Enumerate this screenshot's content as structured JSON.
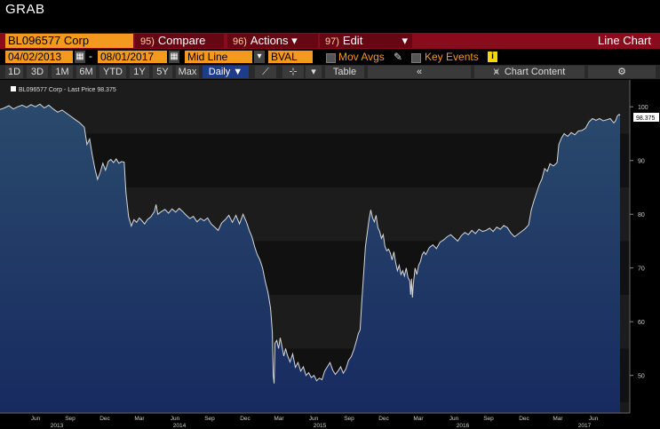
{
  "window": {
    "title": "GRAB"
  },
  "toolbar": {
    "security": "BL096577 Corp",
    "compare": {
      "num": "95)",
      "label": "Compare"
    },
    "actions": {
      "num": "96)",
      "label": "Actions ▾"
    },
    "edit": {
      "num": "97)",
      "label": "Edit"
    },
    "view_title": "Line Chart"
  },
  "controls": {
    "start_date": "04/02/2013",
    "end_date": "08/01/2017",
    "date_separator": "-",
    "line_type": "Mid Line",
    "source": "BVAL",
    "mov_avgs": "Mov Avgs",
    "key_events": "Key Events",
    "key_events_badge": "i"
  },
  "periods": [
    "1D",
    "3D",
    "1M",
    "6M",
    "YTD",
    "1Y",
    "5Y",
    "Max"
  ],
  "frequency": "Daily ▼",
  "tools": {
    "table": "Table",
    "back": "«",
    "chart_content": "Chart Content",
    "settings": "⚙"
  },
  "chart_data": {
    "type": "area",
    "legend": "BL096577 Corp - Last Price 98.375",
    "last_price_label": "98.375",
    "y_ticks": [
      50,
      60,
      70,
      80,
      90,
      100
    ],
    "ylim": [
      43,
      105
    ],
    "x_month_labels": [
      "Jun",
      "Sep",
      "Dec",
      "Mar",
      "Jun",
      "Sep",
      "Dec",
      "Mar",
      "Jun",
      "Sep",
      "Dec",
      "Mar",
      "Jun",
      "Sep",
      "Dec",
      "Mar",
      "Jun"
    ],
    "x_year_labels": [
      "2013",
      "2014",
      "2015",
      "2016",
      "2017"
    ],
    "series": [
      {
        "values": [
          [
            0,
            99.5
          ],
          [
            5,
            99.8
          ],
          [
            10,
            100.2
          ],
          [
            15,
            99.6
          ],
          [
            20,
            100.0
          ],
          [
            25,
            100.3
          ],
          [
            30,
            99.9
          ],
          [
            35,
            100.4
          ],
          [
            40,
            100.0
          ],
          [
            45,
            100.5
          ],
          [
            50,
            99.8
          ],
          [
            55,
            100.3
          ],
          [
            60,
            99.6
          ],
          [
            65,
            99.0
          ],
          [
            70,
            99.4
          ],
          [
            75,
            98.8
          ],
          [
            80,
            98.2
          ],
          [
            85,
            97.6
          ],
          [
            90,
            97.0
          ],
          [
            95,
            96.2
          ],
          [
            98,
            93.0
          ],
          [
            101,
            94.0
          ],
          [
            104,
            91.0
          ],
          [
            107,
            88.5
          ],
          [
            110,
            86.5
          ],
          [
            113,
            87.8
          ],
          [
            116,
            89.5
          ],
          [
            119,
            88.2
          ],
          [
            122,
            89.8
          ],
          [
            125,
            90.2
          ],
          [
            128,
            89.6
          ],
          [
            131,
            90.3
          ],
          [
            134,
            89.5
          ],
          [
            137,
            89.8
          ],
          [
            140,
            89.7
          ],
          [
            142,
            84.0
          ],
          [
            145,
            79.5
          ],
          [
            148,
            77.8
          ],
          [
            151,
            79.0
          ],
          [
            154,
            78.5
          ],
          [
            157,
            79.3
          ],
          [
            160,
            78.8
          ],
          [
            163,
            78.2
          ],
          [
            166,
            79.0
          ],
          [
            170,
            79.5
          ],
          [
            174,
            80.5
          ],
          [
            176,
            81.8
          ],
          [
            178,
            80.0
          ],
          [
            182,
            80.5
          ],
          [
            186,
            80.9
          ],
          [
            190,
            80.2
          ],
          [
            194,
            81.0
          ],
          [
            198,
            80.4
          ],
          [
            202,
            81.1
          ],
          [
            206,
            80.5
          ],
          [
            210,
            79.8
          ],
          [
            214,
            79.2
          ],
          [
            218,
            79.6
          ],
          [
            222,
            78.6
          ],
          [
            226,
            79.2
          ],
          [
            230,
            78.8
          ],
          [
            234,
            79.3
          ],
          [
            238,
            78.2
          ],
          [
            242,
            77.6
          ],
          [
            246,
            77.0
          ],
          [
            250,
            78.4
          ],
          [
            254,
            79.0
          ],
          [
            258,
            79.8
          ],
          [
            262,
            78.5
          ],
          [
            266,
            79.8
          ],
          [
            270,
            78.2
          ],
          [
            274,
            80.0
          ],
          [
            278,
            78.5
          ],
          [
            281,
            77.0
          ],
          [
            284,
            75.8
          ],
          [
            287,
            74.0
          ],
          [
            290,
            72.5
          ],
          [
            293,
            71.5
          ],
          [
            296,
            70.0
          ],
          [
            299,
            67.5
          ],
          [
            302,
            65.5
          ],
          [
            305,
            62.5
          ],
          [
            307,
            58.0
          ],
          [
            308,
            50.0
          ],
          [
            309,
            48.5
          ],
          [
            310,
            56.0
          ],
          [
            312,
            56.5
          ],
          [
            314,
            55.0
          ],
          [
            316,
            57.0
          ],
          [
            318,
            55.3
          ],
          [
            320,
            53.6
          ],
          [
            322,
            55.0
          ],
          [
            324,
            53.8
          ],
          [
            327,
            52.5
          ],
          [
            330,
            54.0
          ],
          [
            333,
            51.5
          ],
          [
            336,
            52.4
          ],
          [
            339,
            50.8
          ],
          [
            342,
            51.6
          ],
          [
            345,
            50.0
          ],
          [
            348,
            50.5
          ],
          [
            351,
            49.6
          ],
          [
            354,
            50.0
          ],
          [
            357,
            49.0
          ],
          [
            360,
            49.5
          ],
          [
            363,
            49.2
          ],
          [
            366,
            50.8
          ],
          [
            369,
            51.6
          ],
          [
            372,
            52.4
          ],
          [
            375,
            51.0
          ],
          [
            378,
            50.2
          ],
          [
            381,
            50.8
          ],
          [
            384,
            51.6
          ],
          [
            387,
            50.4
          ],
          [
            390,
            51.2
          ],
          [
            393,
            52.8
          ],
          [
            396,
            53.5
          ],
          [
            399,
            54.8
          ],
          [
            402,
            56.5
          ],
          [
            404,
            57.8
          ],
          [
            406,
            58.5
          ],
          [
            408,
            64.0
          ],
          [
            410,
            69.0
          ],
          [
            412,
            74.0
          ],
          [
            414,
            76.5
          ],
          [
            416,
            79.0
          ],
          [
            418,
            80.8
          ],
          [
            420,
            79.3
          ],
          [
            422,
            78.6
          ],
          [
            424,
            79.8
          ],
          [
            426,
            77.5
          ],
          [
            428,
            76.8
          ],
          [
            430,
            75.5
          ],
          [
            432,
            76.2
          ],
          [
            434,
            74.0
          ],
          [
            436,
            73.2
          ],
          [
            438,
            73.5
          ],
          [
            440,
            72.8
          ],
          [
            442,
            71.5
          ],
          [
            444,
            73.0
          ],
          [
            446,
            71.0
          ],
          [
            448,
            69.5
          ],
          [
            450,
            70.5
          ],
          [
            452,
            68.8
          ],
          [
            454,
            69.5
          ],
          [
            456,
            68.5
          ],
          [
            458,
            70.0
          ],
          [
            460,
            68.2
          ],
          [
            462,
            67.6
          ],
          [
            463,
            65.0
          ],
          [
            464,
            68.0
          ],
          [
            465,
            64.5
          ],
          [
            466,
            67.0
          ],
          [
            468,
            70.0
          ],
          [
            470,
            68.8
          ],
          [
            472,
            70.5
          ],
          [
            474,
            71.2
          ],
          [
            476,
            72.5
          ],
          [
            478,
            73.0
          ],
          [
            480,
            72.5
          ],
          [
            484,
            73.8
          ],
          [
            488,
            74.3
          ],
          [
            492,
            73.6
          ],
          [
            496,
            74.8
          ],
          [
            500,
            75.2
          ],
          [
            504,
            75.8
          ],
          [
            508,
            76.2
          ],
          [
            512,
            75.6
          ],
          [
            516,
            75.0
          ],
          [
            520,
            76.0
          ],
          [
            524,
            76.6
          ],
          [
            528,
            76.2
          ],
          [
            532,
            77.0
          ],
          [
            536,
            76.4
          ],
          [
            540,
            77.2
          ],
          [
            544,
            76.8
          ],
          [
            548,
            77.0
          ],
          [
            552,
            77.4
          ],
          [
            556,
            76.8
          ],
          [
            560,
            77.6
          ],
          [
            564,
            77.2
          ],
          [
            568,
            77.9
          ],
          [
            572,
            77.5
          ],
          [
            576,
            76.5
          ],
          [
            580,
            75.8
          ],
          [
            584,
            76.3
          ],
          [
            588,
            76.8
          ],
          [
            592,
            77.3
          ],
          [
            596,
            78.0
          ],
          [
            599,
            80.8
          ],
          [
            602,
            82.5
          ],
          [
            605,
            84.0
          ],
          [
            608,
            85.5
          ],
          [
            611,
            86.6
          ],
          [
            614,
            88.5
          ],
          [
            617,
            88.0
          ],
          [
            620,
            89.4
          ],
          [
            624,
            89.0
          ],
          [
            628,
            89.6
          ],
          [
            630,
            93.0
          ],
          [
            633,
            94.2
          ],
          [
            636,
            95.0
          ],
          [
            640,
            94.5
          ],
          [
            644,
            95.2
          ],
          [
            648,
            94.8
          ],
          [
            652,
            95.5
          ],
          [
            656,
            95.6
          ],
          [
            660,
            96.0
          ],
          [
            664,
            97.2
          ],
          [
            668,
            97.8
          ],
          [
            672,
            97.5
          ],
          [
            676,
            97.8
          ],
          [
            680,
            97.4
          ],
          [
            684,
            97.6
          ],
          [
            688,
            97.8
          ],
          [
            692,
            97.0
          ],
          [
            694,
            97.4
          ],
          [
            696,
            98.3
          ],
          [
            698,
            98.6
          ],
          [
            699,
            98.375
          ]
        ]
      }
    ]
  },
  "colors": {
    "accent": "#f39a1e",
    "toolbar_red": "#8a0b1c",
    "area_top": "#27405e",
    "area_bottom": "#16275a",
    "line": "#d8d8d8",
    "selected": "#1c3d8a"
  }
}
